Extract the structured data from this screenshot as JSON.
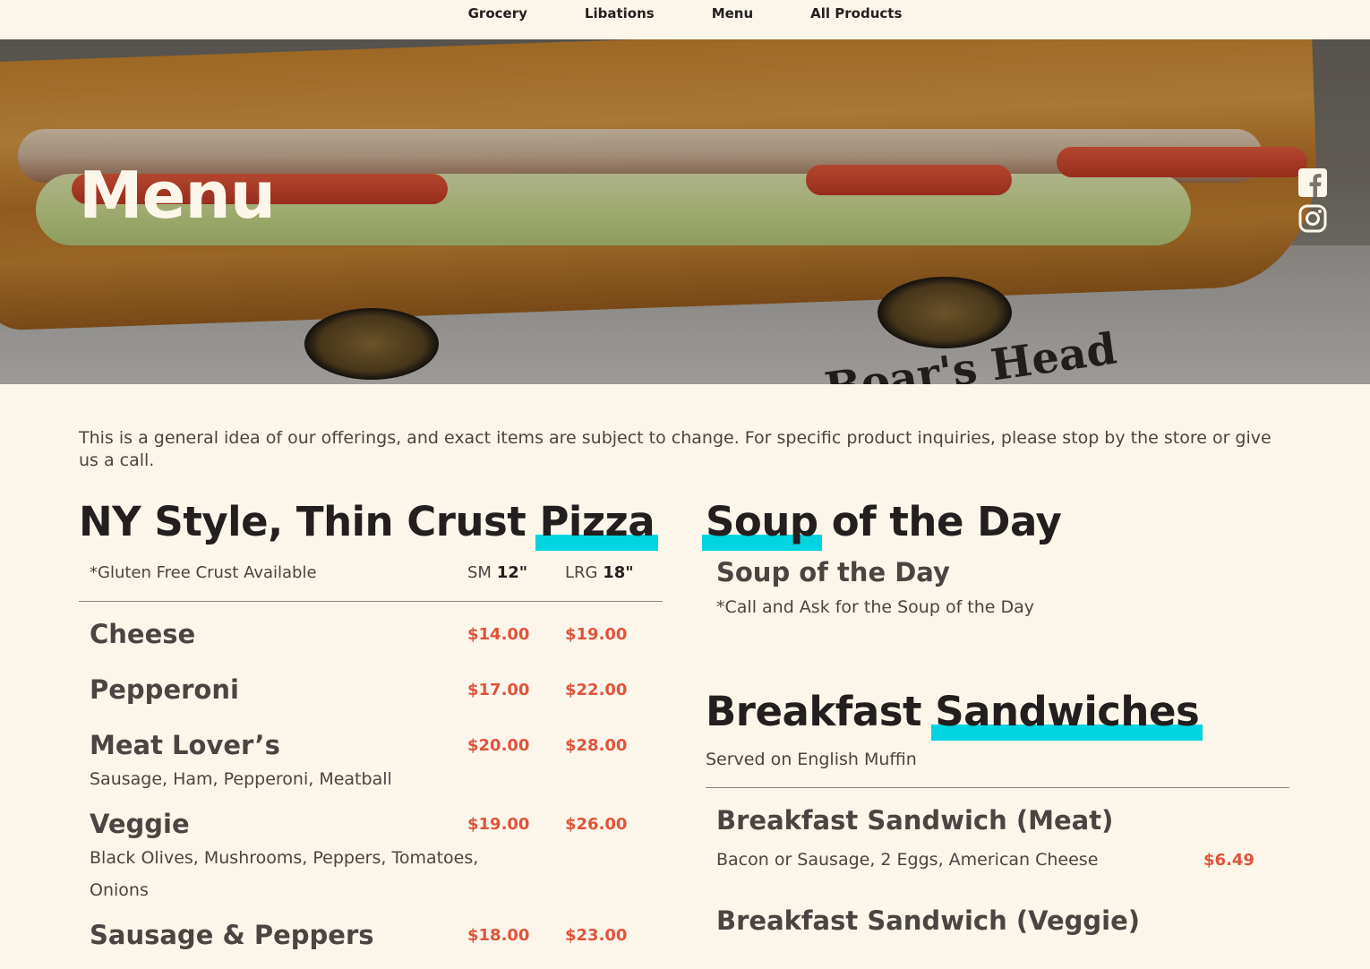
{
  "nav": {
    "links": [
      "Grocery",
      "Libations",
      "Menu",
      "All Products"
    ]
  },
  "hero": {
    "title": "Menu",
    "brand_top": "Boar's Head",
    "brand_bottom": "Boar's Head"
  },
  "intro": "This is a general idea of our offerings, and exact items are subject to change. For specific product inquiries, please stop by the store or give us a call.",
  "pizza": {
    "heading_plain": "NY Style, Thin Crust ",
    "heading_hl": "Pizza",
    "note": "*Gluten Free Crust Available",
    "sm_label": "SM",
    "sm_size": "12\"",
    "lrg_label": "LRG",
    "lrg_size": "18\"",
    "items": [
      {
        "name": "Cheese",
        "sm": "$14.00",
        "lrg": "$19.00",
        "desc": ""
      },
      {
        "name": "Pepperoni",
        "sm": "$17.00",
        "lrg": "$22.00",
        "desc": ""
      },
      {
        "name": "Meat Lover’s",
        "sm": "$20.00",
        "lrg": "$28.00",
        "desc": "Sausage, Ham, Pepperoni, Meatball"
      },
      {
        "name": "Veggie",
        "sm": "$19.00",
        "lrg": "$26.00",
        "desc": "Black Olives, Mushrooms, Peppers, Tomatoes, Onions"
      },
      {
        "name": "Sausage & Peppers",
        "sm": "$18.00",
        "lrg": "$23.00",
        "desc": ""
      }
    ]
  },
  "soup": {
    "heading_hl": "Soup",
    "heading_plain": " of the Day",
    "item_name": "Soup of the Day",
    "note": "*Call and Ask for the Soup of the Day"
  },
  "breakfast": {
    "heading_plain": "Breakfast ",
    "heading_hl": "Sandwiches",
    "sub": "Served on English Muffin",
    "items": [
      {
        "name": "Breakfast Sandwich (Meat)",
        "desc": "Bacon or Sausage, 2 Eggs, American Cheese",
        "price": "$6.49"
      },
      {
        "name": "Breakfast Sandwich (Veggie)"
      }
    ]
  },
  "colors": {
    "background": "#fcf6ea",
    "text": "#231f1f",
    "price": "#e0533a",
    "highlight": "#00d4e0"
  },
  "icons": [
    "facebook-icon",
    "instagram-icon"
  ]
}
